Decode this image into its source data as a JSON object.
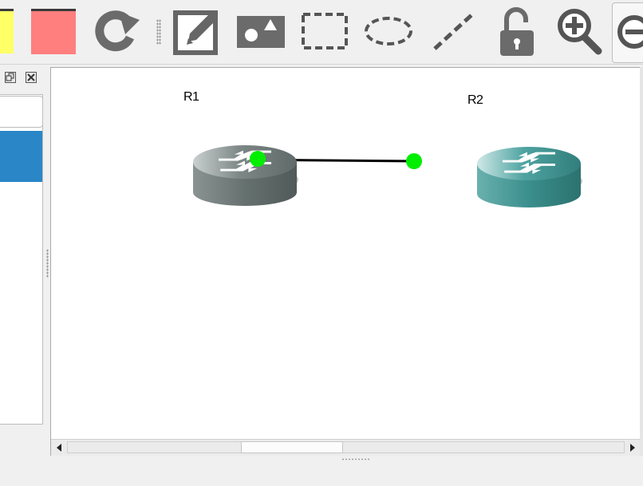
{
  "colors": {
    "note_yellow": "#ffff66",
    "note_red": "#ff7f7f",
    "router_r1": "#6e7d7c",
    "router_r2": "#3a8e8c",
    "link_endpoint": "#00ee00",
    "selection": "#2b86c8"
  },
  "toolbar": {
    "buttons": [
      {
        "name": "yellow-color-swatch",
        "icon": "yellow-swatch"
      },
      {
        "name": "red-color-swatch",
        "icon": "red-swatch"
      },
      {
        "name": "reload-button",
        "icon": "reload-icon"
      },
      {
        "name": "add-note-button",
        "icon": "edit-note-icon"
      },
      {
        "name": "insert-picture-button",
        "icon": "picture-icon"
      },
      {
        "name": "draw-rectangle-button",
        "icon": "rectangle-icon"
      },
      {
        "name": "draw-ellipse-button",
        "icon": "ellipse-icon"
      },
      {
        "name": "draw-line-button",
        "icon": "line-icon"
      },
      {
        "name": "lock-unlock-button",
        "icon": "unlock-icon"
      },
      {
        "name": "zoom-in-button",
        "icon": "zoom-in-icon"
      },
      {
        "name": "zoom-out-button",
        "icon": "zoom-out-icon"
      }
    ]
  },
  "dock": {
    "float_icon": "restore-icon",
    "close_icon": "close-icon",
    "search_value": ""
  },
  "topology": {
    "nodes": [
      {
        "id": "R1",
        "label": "R1",
        "type": "router"
      },
      {
        "id": "R2",
        "label": "R2",
        "type": "router"
      }
    ],
    "links": [
      {
        "from": "R1",
        "to": "R2",
        "status": "up"
      }
    ]
  }
}
